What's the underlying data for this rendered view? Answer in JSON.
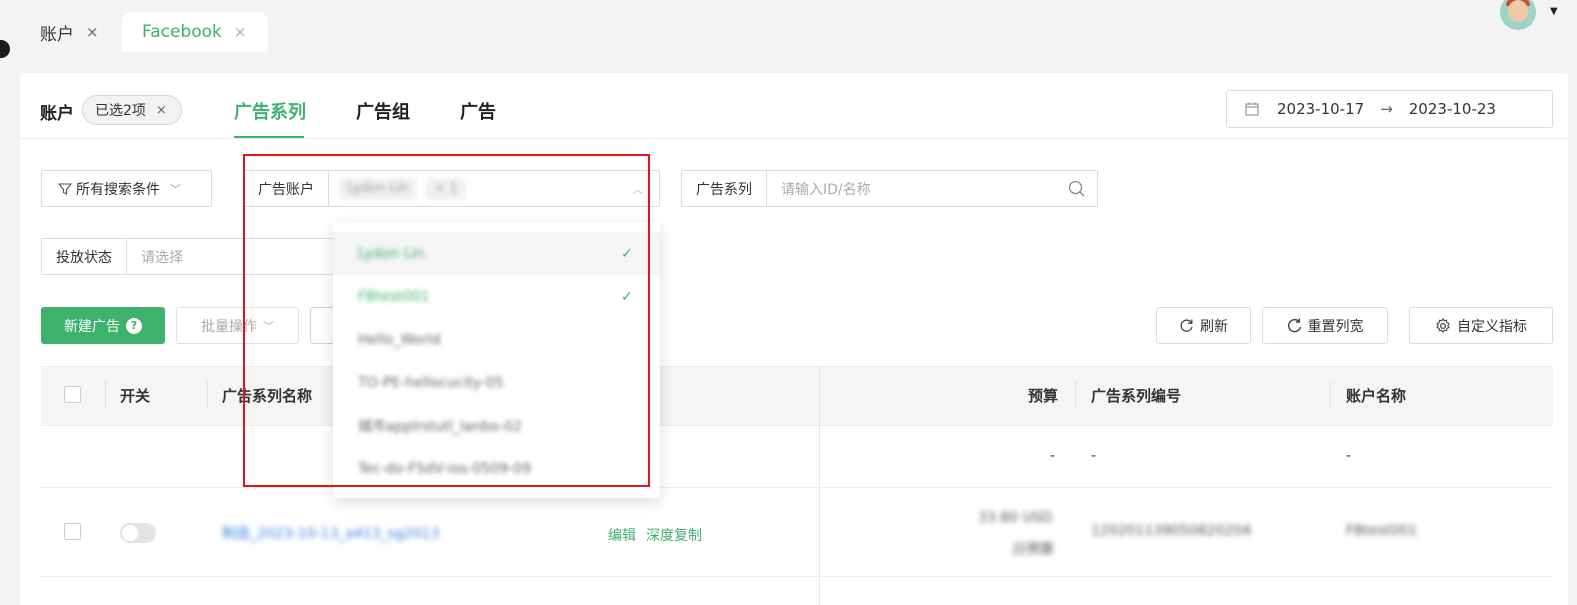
{
  "window_tabs": [
    {
      "label": "账户",
      "close": "×"
    },
    {
      "label": "Facebook",
      "close": "×"
    }
  ],
  "header": {
    "account_label": "账户",
    "account_chip": "已选2项",
    "chip_close": "×",
    "level_tabs": [
      "广告系列",
      "广告组",
      "广告"
    ],
    "date_start": "2023-10-17",
    "date_arrow": "→",
    "date_end": "2023-10-23"
  },
  "filters": {
    "all_conditions": "所有搜索条件",
    "ad_account_label": "广告账户",
    "ad_account_tag": "Lydon Lin",
    "ad_account_more": "+ 1",
    "campaign_label": "广告系列",
    "campaign_placeholder": "请输入ID/名称",
    "status_label": "投放状态",
    "status_placeholder": "请选择"
  },
  "dropdown": {
    "options": [
      {
        "label": "Lydon Lin",
        "selected": true
      },
      {
        "label": "FBtest001",
        "selected": true
      },
      {
        "label": "Hello_World",
        "selected": false
      },
      {
        "label": "TO-PE-hellocucity-05",
        "selected": false
      },
      {
        "label": "城市applrstutl_lanbo-02",
        "selected": false
      },
      {
        "label": "Tec-do-FSdV-ios-0509-09",
        "selected": false
      }
    ],
    "check_glyph": "✓"
  },
  "actions": {
    "new_ad": "新建广告",
    "help_glyph": "?",
    "batch": "批量操作",
    "refresh": "刷新",
    "reset_width": "重置列宽",
    "custom_metrics": "自定义指标"
  },
  "table": {
    "headers": {
      "switch": "开关",
      "campaign_name": "广告系列名称",
      "budget": "预算",
      "campaign_id": "广告系列编号",
      "account_name": "账户名称"
    },
    "summary_row": {
      "budget": "-",
      "campaign_id": "-",
      "account_name": "-"
    },
    "rows": [
      {
        "campaign_name": "制造_2023-10-13_a413_sg2013",
        "edit": "编辑",
        "deep_copy": "深度复制",
        "budget": "33.80 USD",
        "budget_note": "日预算",
        "campaign_id": "120201139050820204",
        "account_name": "FBtest001"
      }
    ]
  },
  "colors": {
    "accent": "#3db26d",
    "annotation": "#e4141b"
  }
}
